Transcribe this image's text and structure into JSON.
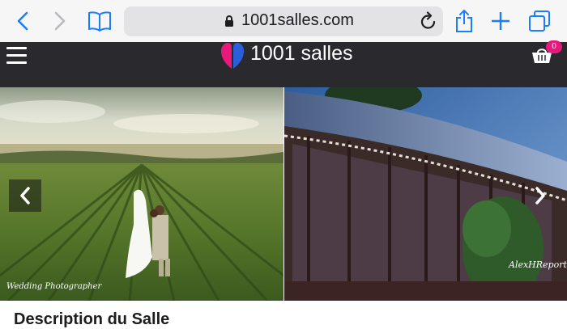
{
  "browser": {
    "url": "1001salles.com",
    "accent": "#1a7dff"
  },
  "site": {
    "brand": "1001 salles",
    "cart_count": "0",
    "brand_pink": "#e8197a",
    "brand_blue": "#2b5fd9",
    "header_bg": "#2a2a2e"
  },
  "gallery": {
    "photos": [
      {
        "alt": "wedding couple in vineyard",
        "watermark": "Wedding Photographer"
      },
      {
        "alt": "glass veranda venue at dusk",
        "watermark": "AlexHReporta"
      }
    ]
  },
  "content": {
    "heading_partial": "Description du Salle"
  }
}
